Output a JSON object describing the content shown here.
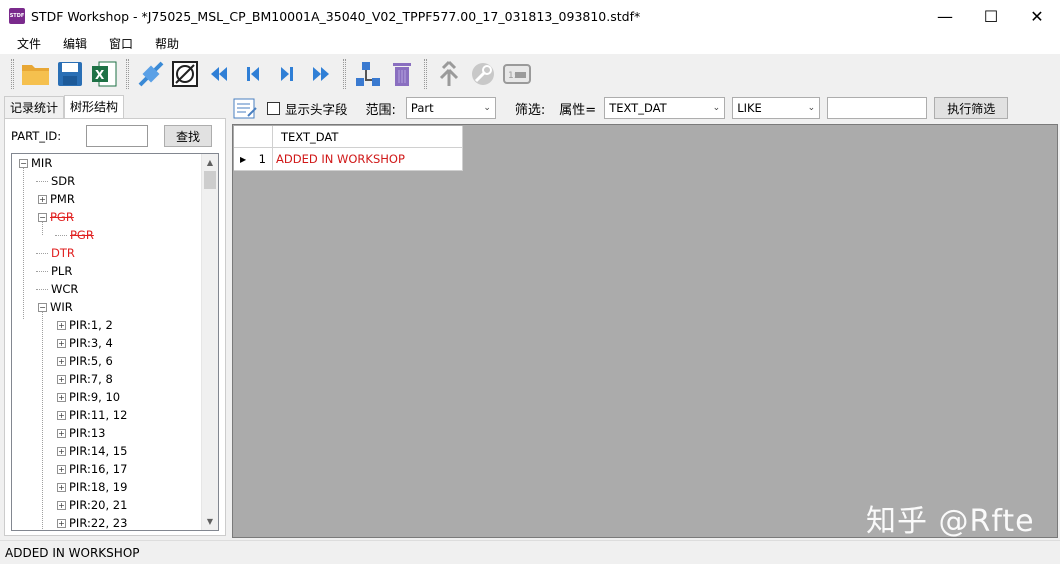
{
  "window": {
    "app_icon_text": "STDF",
    "title": "STDF Workshop - *J75025_MSL_CP_BM10001A_35040_V02_TPPF577.00_17_031813_093810.stdf*",
    "minimize": "—",
    "maximize": "☐",
    "close": "✕"
  },
  "menu": [
    "文件",
    "编辑",
    "窗口",
    "帮助"
  ],
  "toolbar": {
    "buttons": [
      {
        "name": "open-folder-icon",
        "color": "#e8a735"
      },
      {
        "name": "save-icon",
        "color": "#2a6fb5"
      },
      {
        "name": "excel-export-icon",
        "color": "#1e7145"
      },
      {
        "name": "connect-icon",
        "color": "#3a8ad6"
      },
      {
        "name": "disconnect-icon",
        "color": "#222222"
      },
      {
        "name": "first-icon",
        "color": "#2f7fd6"
      },
      {
        "name": "previous-icon",
        "color": "#2f7fd6"
      },
      {
        "name": "next-icon",
        "color": "#2f7fd6"
      },
      {
        "name": "last-icon",
        "color": "#2f7fd6"
      },
      {
        "name": "tree-structure-icon",
        "color": "#3a7ad0"
      },
      {
        "name": "delete-icon",
        "color": "#8a6fc0"
      },
      {
        "name": "merge-icon",
        "color": "#9a9a9a"
      },
      {
        "name": "settings-icon",
        "color": "#9a9a9a"
      },
      {
        "name": "console-icon",
        "color": "#9a9a9a"
      }
    ]
  },
  "left": {
    "tabs": [
      "记录统计",
      "树形结构"
    ],
    "active_tab": 1,
    "part_id_label": "PART_ID:",
    "part_id_value": "",
    "search_button": "查找",
    "tree": [
      {
        "label": "MIR",
        "level": 0,
        "expander": "−",
        "style": "normal"
      },
      {
        "label": "SDR",
        "level": 1,
        "expander": "",
        "style": "normal"
      },
      {
        "label": "PMR",
        "level": 1,
        "expander": "+",
        "style": "normal"
      },
      {
        "label": "PGR",
        "level": 1,
        "expander": "−",
        "style": "deleted"
      },
      {
        "label": "PGR",
        "level": 2,
        "expander": "",
        "style": "deleted"
      },
      {
        "label": "DTR",
        "level": 1,
        "expander": "",
        "style": "added"
      },
      {
        "label": "PLR",
        "level": 1,
        "expander": "",
        "style": "normal"
      },
      {
        "label": "WCR",
        "level": 1,
        "expander": "",
        "style": "normal"
      },
      {
        "label": "WIR",
        "level": 1,
        "expander": "−",
        "style": "normal"
      },
      {
        "label": "PIR:1, 2",
        "level": 2,
        "expander": "+",
        "style": "normal"
      },
      {
        "label": "PIR:3, 4",
        "level": 2,
        "expander": "+",
        "style": "normal"
      },
      {
        "label": "PIR:5, 6",
        "level": 2,
        "expander": "+",
        "style": "normal"
      },
      {
        "label": "PIR:7, 8",
        "level": 2,
        "expander": "+",
        "style": "normal"
      },
      {
        "label": "PIR:9, 10",
        "level": 2,
        "expander": "+",
        "style": "normal"
      },
      {
        "label": "PIR:11, 12",
        "level": 2,
        "expander": "+",
        "style": "normal"
      },
      {
        "label": "PIR:13",
        "level": 2,
        "expander": "+",
        "style": "normal"
      },
      {
        "label": "PIR:14, 15",
        "level": 2,
        "expander": "+",
        "style": "normal"
      },
      {
        "label": "PIR:16, 17",
        "level": 2,
        "expander": "+",
        "style": "normal"
      },
      {
        "label": "PIR:18, 19",
        "level": 2,
        "expander": "+",
        "style": "normal"
      },
      {
        "label": "PIR:20, 21",
        "level": 2,
        "expander": "+",
        "style": "normal"
      },
      {
        "label": "PIR:22, 23",
        "level": 2,
        "expander": "+",
        "style": "normal"
      }
    ]
  },
  "right": {
    "show_header_label": "显示头字段",
    "show_header_checked": false,
    "range_label": "范围:",
    "range_value": "Part",
    "filter_label": "筛选:",
    "attr_label": "属性=",
    "attr_value": "TEXT_DAT",
    "op_value": "LIKE",
    "filter_value": "",
    "exec_button": "执行筛选",
    "grid": {
      "columns": [
        "TEXT_DAT"
      ],
      "rows": [
        {
          "index": "1",
          "cells": [
            "ADDED IN WORKSHOP"
          ]
        }
      ]
    }
  },
  "status": "ADDED IN WORKSHOP",
  "watermark": "知乎 @Rfte",
  "colors": {
    "deleted": "#e02020",
    "added": "#e02020",
    "added_text": "#d01818"
  }
}
